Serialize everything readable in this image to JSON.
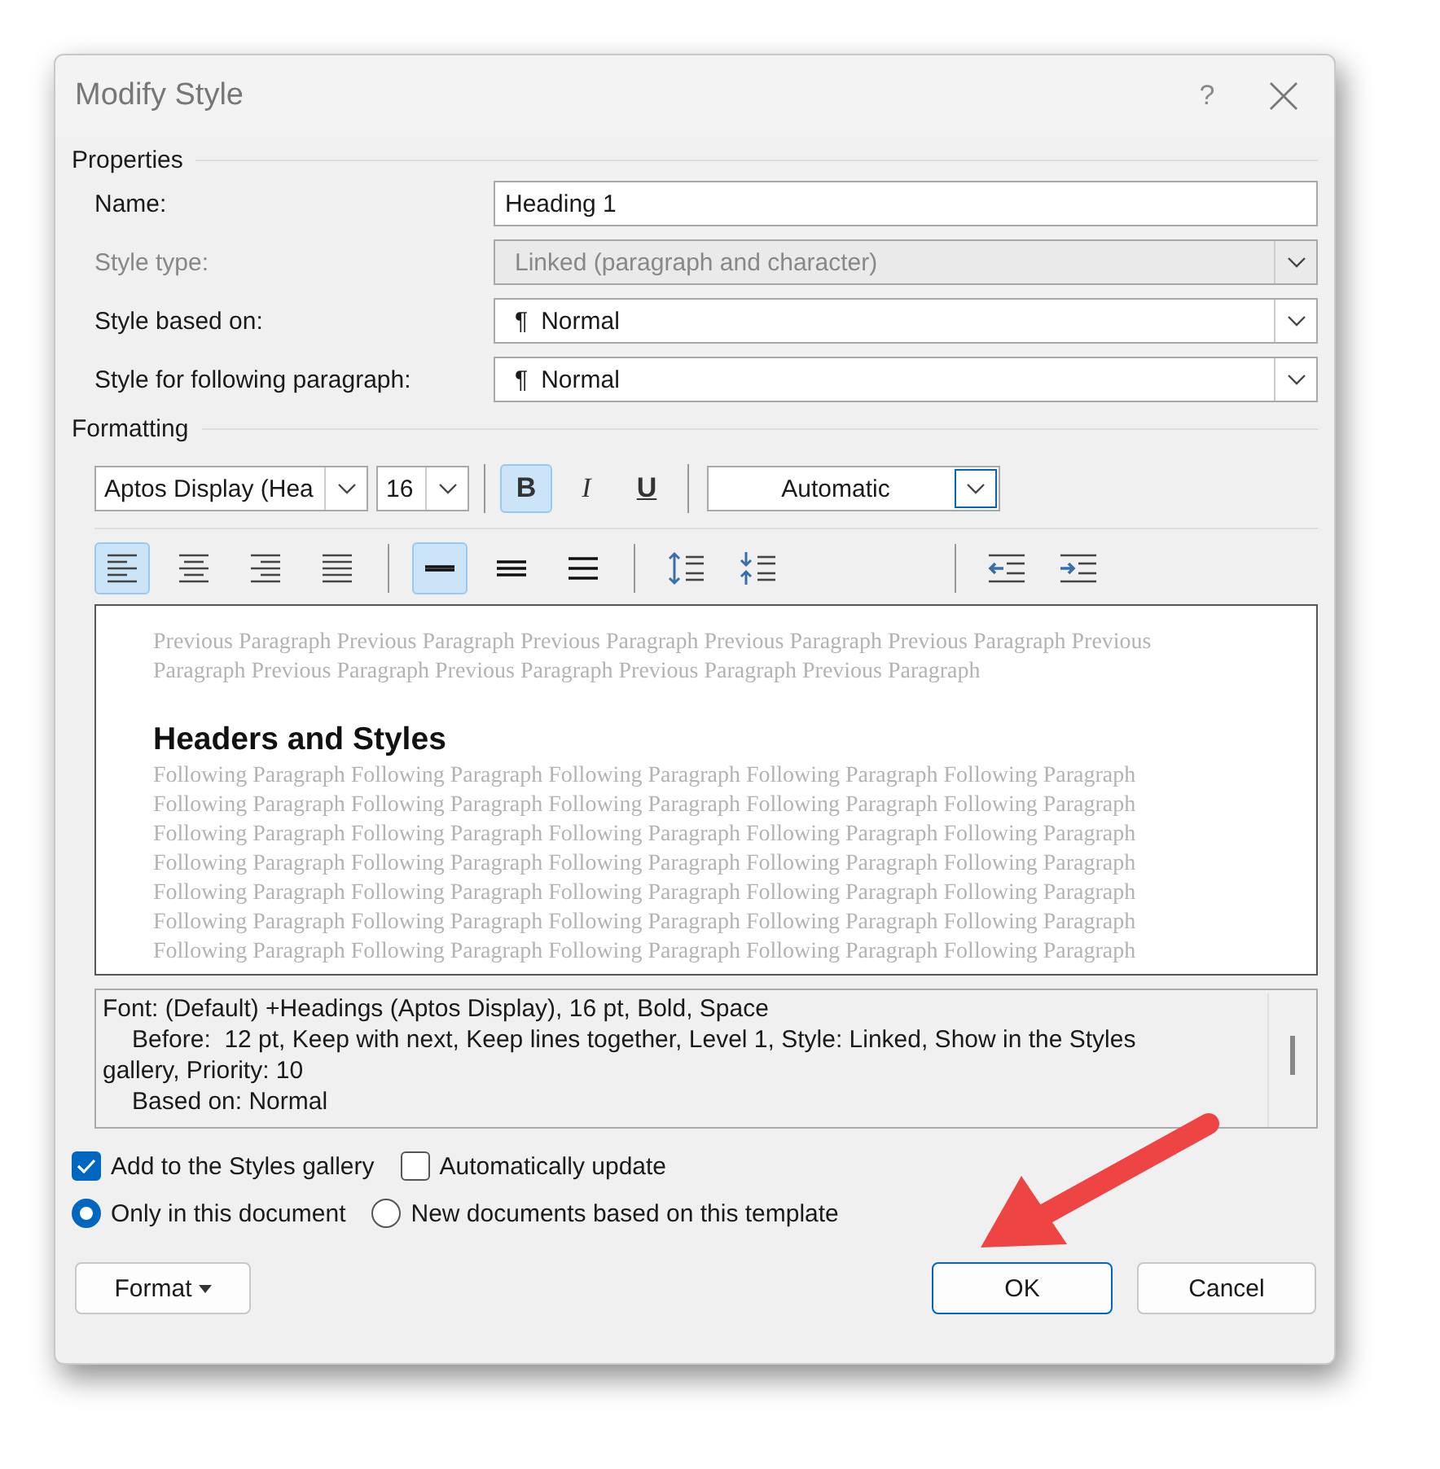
{
  "window": {
    "title": "Modify Style",
    "help": "?"
  },
  "properties": {
    "heading": "Properties",
    "rows": [
      {
        "kind": "text",
        "label": "Name:",
        "value": "Heading 1",
        "disabled": false
      },
      {
        "kind": "combo",
        "label": "Style type:",
        "value": "Linked (paragraph and character)",
        "disabled": true
      },
      {
        "kind": "combo",
        "label": "Style based on:",
        "value": "Normal",
        "mark": "¶",
        "disabled": false
      },
      {
        "kind": "combo",
        "label": "Style for following paragraph:",
        "value": "Normal",
        "mark": "¶",
        "disabled": false
      }
    ]
  },
  "formatting": {
    "heading": "Formatting",
    "font": "Aptos Display (Hea",
    "size": "16",
    "styles": [
      {
        "label": "B",
        "kind": "bold",
        "selected": true
      },
      {
        "label": "I",
        "kind": "italic",
        "selected": false
      },
      {
        "label": "U",
        "kind": "underline",
        "selected": false
      }
    ],
    "color_setting": "Automatic",
    "alignment": [
      {
        "kind": "left",
        "selected": true
      },
      {
        "kind": "center",
        "selected": false
      },
      {
        "kind": "right",
        "selected": false
      },
      {
        "kind": "justify",
        "selected": false
      }
    ],
    "line_spacing": [
      {
        "kind": "single",
        "selected": true
      },
      {
        "kind": "one-half",
        "selected": false
      },
      {
        "kind": "double",
        "selected": false
      }
    ],
    "paragraph_spacing": [
      {
        "kind": "increase"
      },
      {
        "kind": "decrease"
      }
    ],
    "indent": [
      {
        "kind": "decrease"
      },
      {
        "kind": "increase"
      }
    ]
  },
  "preview": {
    "previous_lines": [
      "Previous Paragraph Previous Paragraph Previous Paragraph Previous Paragraph Previous Paragraph Previous",
      "Paragraph Previous Paragraph Previous Paragraph Previous Paragraph Previous Paragraph"
    ],
    "heading": "Headers and Styles",
    "following_lines": [
      "Following Paragraph Following Paragraph Following Paragraph Following Paragraph Following Paragraph",
      "Following Paragraph Following Paragraph Following Paragraph Following Paragraph Following Paragraph",
      "Following Paragraph Following Paragraph Following Paragraph Following Paragraph Following Paragraph",
      "Following Paragraph Following Paragraph Following Paragraph Following Paragraph Following Paragraph",
      "Following Paragraph Following Paragraph Following Paragraph Following Paragraph Following Paragraph",
      "Following Paragraph Following Paragraph Following Paragraph Following Paragraph Following Paragraph",
      "Following Paragraph Following Paragraph Following Paragraph Following Paragraph Following Paragraph"
    ]
  },
  "description": [
    {
      "text": "Font: (Default) +Headings (Aptos Display), 16 pt, Bold, Space",
      "indented": false
    },
    {
      "text": "Before:  12 pt, Keep with next, Keep lines together, Level 1, Style: Linked, Show in the Styles",
      "indented": true
    },
    {
      "text": "gallery, Priority: 10",
      "indented": false
    },
    {
      "text": "Based on: Normal",
      "indented": true
    }
  ],
  "checkboxes": [
    {
      "label": "Add to the Styles gallery",
      "checked": true
    },
    {
      "label": "Automatically update",
      "checked": false
    }
  ],
  "radios": [
    {
      "label": "Only in this document",
      "selected": true
    },
    {
      "label": "New documents based on this template",
      "selected": false
    }
  ],
  "buttons": [
    {
      "label": "Format",
      "kind": "menu"
    },
    {
      "label": "OK",
      "kind": "default"
    },
    {
      "label": "Cancel",
      "kind": "normal"
    }
  ]
}
